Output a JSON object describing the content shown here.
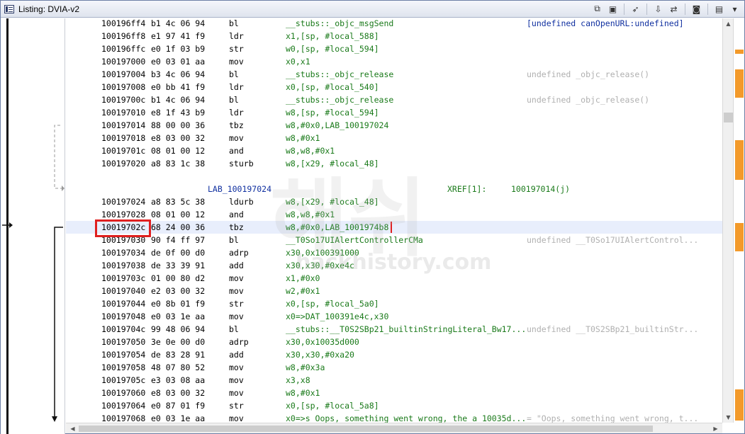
{
  "window": {
    "title": "Listing:  DVIA-v2"
  },
  "toolbar": {
    "icons": [
      "copy-icon",
      "paste-icon",
      "cursor-icon",
      "save-icon",
      "diff-icon",
      "snapshot-icon",
      "columns-icon",
      "menu-icon"
    ]
  },
  "rows": [
    {
      "addr": "100196ff4",
      "bytes": "b1 4c 06 94",
      "mnem": "bl",
      "ops": "__stubs::_objc_msgSend",
      "cmt": "[undefined canOpenURL:undefined]",
      "cmt_active": true
    },
    {
      "addr": "100196ff8",
      "bytes": "e1 97 41 f9",
      "mnem": "ldr",
      "ops": "x1,[sp, #local_588]",
      "cmt": ""
    },
    {
      "addr": "100196ffc",
      "bytes": "e0 1f 03 b9",
      "mnem": "str",
      "ops": "w0,[sp, #local_594]",
      "cmt": ""
    },
    {
      "addr": "100197000",
      "bytes": "e0 03 01 aa",
      "mnem": "mov",
      "ops": "x0,x1",
      "cmt": ""
    },
    {
      "addr": "100197004",
      "bytes": "b3 4c 06 94",
      "mnem": "bl",
      "ops": "__stubs::_objc_release",
      "cmt": "undefined _objc_release()"
    },
    {
      "addr": "100197008",
      "bytes": "e0 bb 41 f9",
      "mnem": "ldr",
      "ops": "x0,[sp, #local_540]",
      "cmt": ""
    },
    {
      "addr": "10019700c",
      "bytes": "b1 4c 06 94",
      "mnem": "bl",
      "ops": "__stubs::_objc_release",
      "cmt": "undefined _objc_release()"
    },
    {
      "addr": "100197010",
      "bytes": "e8 1f 43 b9",
      "mnem": "ldr",
      "ops": "w8,[sp, #local_594]",
      "cmt": ""
    },
    {
      "addr": "100197014",
      "bytes": "88 00 00 36",
      "mnem": "tbz",
      "ops": "w8,#0x0,LAB_100197024",
      "cmt": ""
    },
    {
      "addr": "100197018",
      "bytes": "e8 03 00 32",
      "mnem": "mov",
      "ops": "w8,#0x1",
      "cmt": ""
    },
    {
      "addr": "10019701c",
      "bytes": "08 01 00 12",
      "mnem": "and",
      "ops": "w8,w8,#0x1",
      "cmt": ""
    },
    {
      "addr": "100197020",
      "bytes": "a8 83 1c 38",
      "mnem": "sturb",
      "ops": "w8,[x29, #local_48]",
      "cmt": ""
    },
    {
      "addr": "100197024",
      "bytes": "a8 83 5c 38",
      "mnem": "ldurb",
      "ops": "w8,[x29, #local_48]",
      "cmt": ""
    },
    {
      "addr": "100197028",
      "bytes": "08 01 00 12",
      "mnem": "and",
      "ops": "w8,w8,#0x1",
      "cmt": ""
    },
    {
      "addr": "10019702c",
      "bytes": "68 24 00 36",
      "mnem": "tbz",
      "ops": "w8,#0x0,LAB_1001974b8",
      "cmt": ""
    },
    {
      "addr": "100197030",
      "bytes": "90 f4 ff 97",
      "mnem": "bl",
      "ops": "__T0So17UIAlertControllerCMa",
      "cmt": "undefined __T0So17UIAlertControl..."
    },
    {
      "addr": "100197034",
      "bytes": "de 0f 00 d0",
      "mnem": "adrp",
      "ops": "x30,0x100391000",
      "cmt": ""
    },
    {
      "addr": "100197038",
      "bytes": "de 33 39 91",
      "mnem": "add",
      "ops": "x30,x30,#0xe4c",
      "cmt": ""
    },
    {
      "addr": "10019703c",
      "bytes": "01 00 80 d2",
      "mnem": "mov",
      "ops": "x1,#0x0",
      "cmt": ""
    },
    {
      "addr": "100197040",
      "bytes": "e2 03 00 32",
      "mnem": "mov",
      "ops": "w2,#0x1",
      "cmt": ""
    },
    {
      "addr": "100197044",
      "bytes": "e0 8b 01 f9",
      "mnem": "str",
      "ops": "x0,[sp, #local_5a0]",
      "cmt": ""
    },
    {
      "addr": "100197048",
      "bytes": "e0 03 1e aa",
      "mnem": "mov",
      "ops": "x0=>DAT_100391e4c,x30",
      "cmt": ""
    },
    {
      "addr": "10019704c",
      "bytes": "99 48 06 94",
      "mnem": "bl",
      "ops": "__stubs::__T0S2SBp21_builtinStringLiteral_Bw17...",
      "cmt": "undefined __T0S2SBp21_builtinStr..."
    },
    {
      "addr": "100197050",
      "bytes": "3e 0e 00 d0",
      "mnem": "adrp",
      "ops": "x30,0x10035d000",
      "cmt": ""
    },
    {
      "addr": "100197054",
      "bytes": "de 83 28 91",
      "mnem": "add",
      "ops": "x30,x30,#0xa20",
      "cmt": ""
    },
    {
      "addr": "100197058",
      "bytes": "48 07 80 52",
      "mnem": "mov",
      "ops": "w8,#0x3a",
      "cmt": ""
    },
    {
      "addr": "10019705c",
      "bytes": "e3 03 08 aa",
      "mnem": "mov",
      "ops": "x3,x8",
      "cmt": ""
    },
    {
      "addr": "100197060",
      "bytes": "e8 03 00 32",
      "mnem": "mov",
      "ops": "w8,#0x1",
      "cmt": ""
    },
    {
      "addr": "100197064",
      "bytes": "e0 87 01 f9",
      "mnem": "str",
      "ops": "x0,[sp, #local_5a8]",
      "cmt": ""
    },
    {
      "addr": "100197068",
      "bytes": "e0 03 1e aa",
      "mnem": "mov",
      "ops": "x0=>s Oops, something went wrong, the a 10035d...",
      "cmt": "= \"Oops, something went wrong, t..."
    }
  ],
  "label_row": {
    "label": "LAB_100197024",
    "xref": "XREF[1]:",
    "xref_value": "100197014(j)"
  },
  "highlight_addr": "10019702c",
  "watermark": {
    "big": "해쉬",
    "small": "hackhistory.com"
  },
  "minimap_color": "#f39a2a"
}
